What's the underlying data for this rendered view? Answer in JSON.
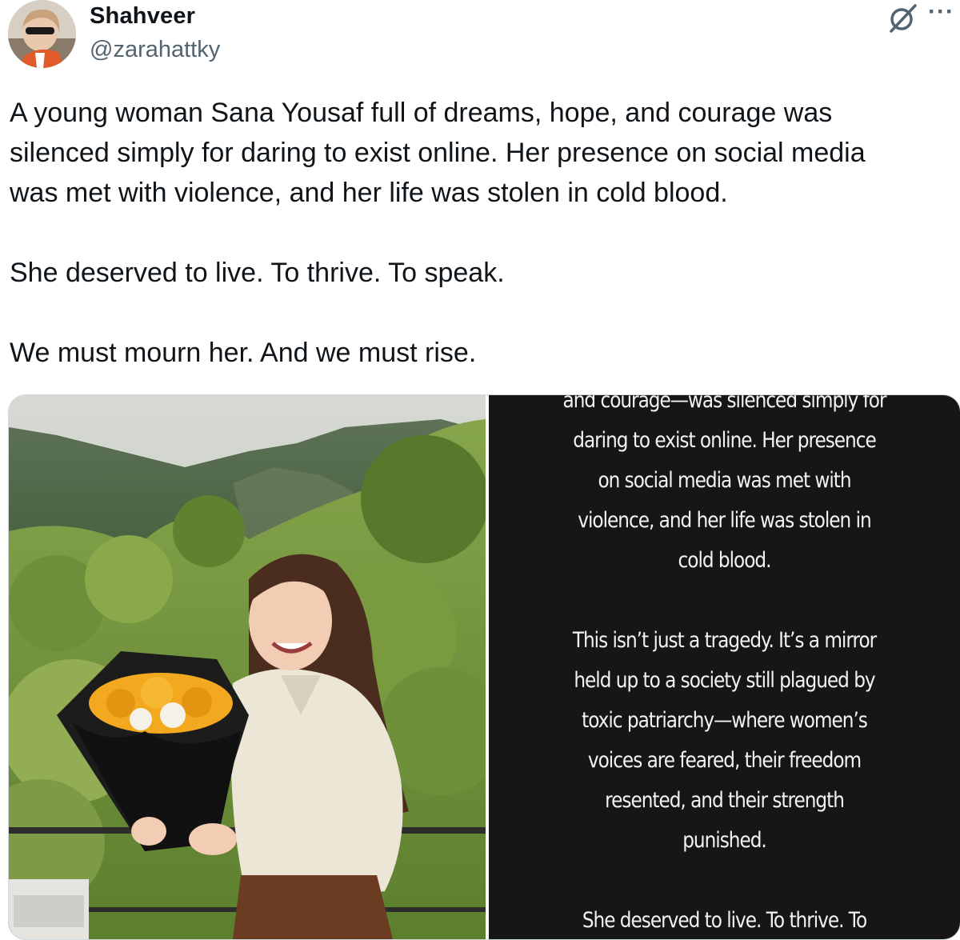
{
  "author": {
    "name": "Shahveer",
    "handle": "@zarahattky"
  },
  "icons": {
    "brand": "grok-icon",
    "more": "more-options-icon"
  },
  "tweet": {
    "paragraphs": [
      "A young woman Sana Yousaf full of dreams, hope, and courage was\nsilenced simply for daring to exist online. Her presence on social media\nwas met with violence, and her life was stolen in cold blood.",
      "She deserved to live. To thrive. To speak.",
      "We must mourn her. And we must rise."
    ]
  },
  "media": {
    "photo_alt": "Young woman holding a bouquet of sunflowers in front of green hills",
    "story_paragraphs": [
      "and courage—was silenced simply for\ndaring to exist online. Her presence\non social media was met with\nviolence, and her life was stolen in\ncold blood.",
      "This isn’t just a tragedy. It’s a mirror\nheld up to a society still plagued by\ntoxic patriarchy—where women’s\nvoices are feared, their freedom\nresented, and their strength\npunished.",
      "She deserved to live. To thrive. To"
    ]
  },
  "colors": {
    "text": "#0f1419",
    "secondary": "#536471",
    "border": "#cfd9de",
    "story_bg": "#161616"
  }
}
